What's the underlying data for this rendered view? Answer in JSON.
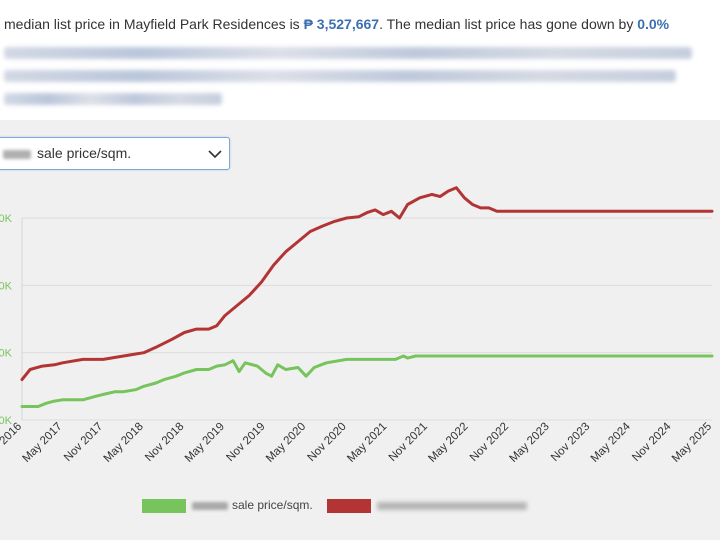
{
  "summary": {
    "prefix": "median list price in Mayfield Park Residences is ",
    "median_price": "₱ 3,527,667",
    "middle": ". The median list price has gone down by ",
    "change_pct": "0.0%"
  },
  "metric_select": {
    "selected": "sale price/sqm."
  },
  "legend": {
    "green_label": "sale price/sqm."
  },
  "colors": {
    "green": "#77c35c",
    "red": "#b23434",
    "accent_text": "#3d6fb0",
    "y_tick_text": "#77c35c"
  },
  "chart_data": {
    "type": "line",
    "x_ticks": [
      "v 2016",
      "May 2017",
      "Nov 2017",
      "May 2018",
      "Nov 2018",
      "May 2019",
      "Nov 2019",
      "May 2020",
      "Nov 2020",
      "May 2021",
      "Nov 2021",
      "May 2022",
      "Nov 2022",
      "May 2023",
      "Nov 2023",
      "May 2024",
      "Nov 2024",
      "May 2025"
    ],
    "y_ticks": [
      "0K",
      "0K",
      "0K",
      "0K"
    ],
    "grid": true,
    "legend_position": "bottom",
    "series": [
      {
        "color": "#77c35c",
        "points": [
          [
            0,
            0.2
          ],
          [
            0.2,
            0.2
          ],
          [
            0.4,
            0.2
          ],
          [
            0.6,
            0.25
          ],
          [
            0.8,
            0.28
          ],
          [
            1.0,
            0.3
          ],
          [
            1.5,
            0.3
          ],
          [
            1.8,
            0.35
          ],
          [
            2.0,
            0.38
          ],
          [
            2.3,
            0.42
          ],
          [
            2.5,
            0.42
          ],
          [
            2.8,
            0.45
          ],
          [
            3.0,
            0.5
          ],
          [
            3.3,
            0.55
          ],
          [
            3.5,
            0.6
          ],
          [
            3.8,
            0.65
          ],
          [
            4.0,
            0.7
          ],
          [
            4.3,
            0.75
          ],
          [
            4.6,
            0.75
          ],
          [
            4.8,
            0.8
          ],
          [
            5.0,
            0.82
          ],
          [
            5.2,
            0.88
          ],
          [
            5.35,
            0.72
          ],
          [
            5.5,
            0.85
          ],
          [
            5.8,
            0.8
          ],
          [
            6.0,
            0.7
          ],
          [
            6.15,
            0.65
          ],
          [
            6.3,
            0.82
          ],
          [
            6.5,
            0.75
          ],
          [
            6.8,
            0.78
          ],
          [
            7.0,
            0.65
          ],
          [
            7.2,
            0.78
          ],
          [
            7.5,
            0.85
          ],
          [
            8.0,
            0.9
          ],
          [
            8.5,
            0.9
          ],
          [
            9.0,
            0.9
          ],
          [
            9.2,
            0.9
          ],
          [
            9.4,
            0.95
          ],
          [
            9.5,
            0.92
          ],
          [
            9.7,
            0.95
          ],
          [
            10,
            0.95
          ],
          [
            12,
            0.95
          ],
          [
            14.5,
            0.95
          ],
          [
            17,
            0.95
          ]
        ]
      },
      {
        "color": "#b23434",
        "points": [
          [
            0,
            0.6
          ],
          [
            0.2,
            0.75
          ],
          [
            0.5,
            0.8
          ],
          [
            0.8,
            0.82
          ],
          [
            1.0,
            0.85
          ],
          [
            1.5,
            0.9
          ],
          [
            2.0,
            0.9
          ],
          [
            2.5,
            0.95
          ],
          [
            3.0,
            1.0
          ],
          [
            3.3,
            1.08
          ],
          [
            3.7,
            1.2
          ],
          [
            4.0,
            1.3
          ],
          [
            4.3,
            1.35
          ],
          [
            4.6,
            1.35
          ],
          [
            4.8,
            1.4
          ],
          [
            5.0,
            1.55
          ],
          [
            5.3,
            1.7
          ],
          [
            5.6,
            1.85
          ],
          [
            5.9,
            2.05
          ],
          [
            6.2,
            2.3
          ],
          [
            6.5,
            2.5
          ],
          [
            6.8,
            2.65
          ],
          [
            7.1,
            2.8
          ],
          [
            7.4,
            2.88
          ],
          [
            7.7,
            2.95
          ],
          [
            8.0,
            3.0
          ],
          [
            8.3,
            3.02
          ],
          [
            8.5,
            3.08
          ],
          [
            8.7,
            3.12
          ],
          [
            8.9,
            3.05
          ],
          [
            9.1,
            3.1
          ],
          [
            9.3,
            3.0
          ],
          [
            9.5,
            3.2
          ],
          [
            9.8,
            3.3
          ],
          [
            10.1,
            3.35
          ],
          [
            10.3,
            3.32
          ],
          [
            10.5,
            3.4
          ],
          [
            10.7,
            3.45
          ],
          [
            10.9,
            3.3
          ],
          [
            11.1,
            3.2
          ],
          [
            11.3,
            3.15
          ],
          [
            11.5,
            3.15
          ],
          [
            11.7,
            3.1
          ],
          [
            12,
            3.1
          ],
          [
            14.5,
            3.1
          ],
          [
            17,
            3.1
          ]
        ]
      }
    ]
  }
}
